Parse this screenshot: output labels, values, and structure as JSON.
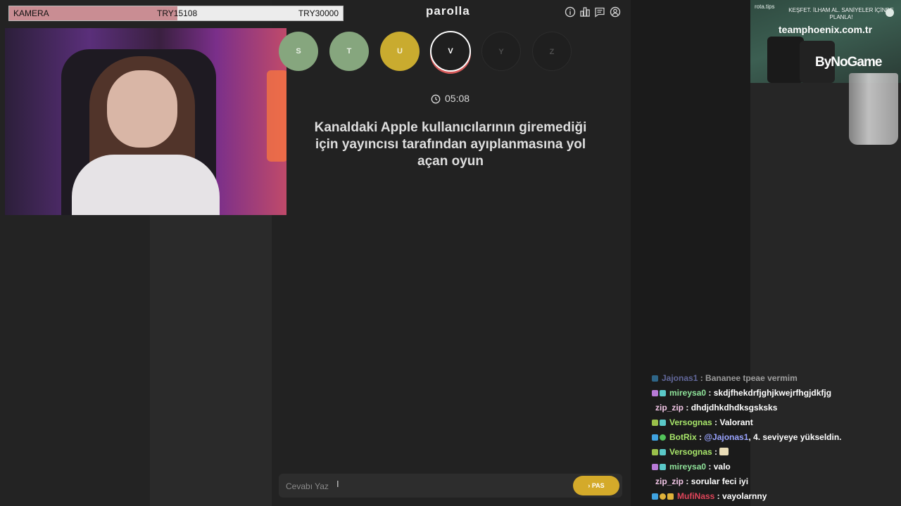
{
  "donation": {
    "label": "KAMERA",
    "current": "TRY15108",
    "goal": "TRY30000",
    "progress_fraction": 0.504
  },
  "header": {
    "logo": "parolla"
  },
  "header_icons": [
    "info-icon",
    "stats-icon",
    "feedback-icon",
    "account-icon"
  ],
  "letters": [
    {
      "letter": "S",
      "state": "correct"
    },
    {
      "letter": "T",
      "state": "correct"
    },
    {
      "letter": "U",
      "state": "passed"
    },
    {
      "letter": "V",
      "state": "active"
    },
    {
      "letter": "Y",
      "state": "pending"
    },
    {
      "letter": "Z",
      "state": "pending"
    }
  ],
  "timer": "05:08",
  "question": "Kanaldaki Apple kullanıcılarının giremediği için yayıncısı tarafından ayıplanmasına yol açan oyun",
  "answer": {
    "placeholder": "Cevabı Yaz",
    "pass_label": "PAS"
  },
  "ad": {
    "brand": "rota.tips",
    "tagline": "KEŞFET. İLHAM AL. SANİYELER İÇİNDE PLANLA!",
    "site": "teamphoenix.com.tr",
    "logo": "ByNoGame"
  },
  "chat": [
    {
      "user": "Jajonas1",
      "message": "Bananee tpeae vermim",
      "user_color": "#9aa4ff"
    },
    {
      "user": "mireysa0",
      "message": "skdjfhekdrfjghjkwejrfhgjdkfjg",
      "user_color": "#8fe39a"
    },
    {
      "user": "zip_zip",
      "message": "dhdjdhkdhdksgsksks",
      "user_color": "#f2c6e6"
    },
    {
      "user": "Versognas",
      "message": "Valorant",
      "user_color": "#a8e66a"
    },
    {
      "user": "BotRix",
      "message_mention": "@Jajonas1",
      "message": ", 4. seviyeye yükseldin.",
      "user_color": "#a8e66a"
    },
    {
      "user": "Versognas",
      "message": "",
      "emote": "emote",
      "user_color": "#a8e66a"
    },
    {
      "user": "mireysa0",
      "message": "valo",
      "user_color": "#8fe39a"
    },
    {
      "user": "zip_zip",
      "message": "sorular feci iyi",
      "user_color": "#f2c6e6"
    },
    {
      "user": "MufiNass",
      "message": "vayolarnny",
      "user_color": "#e0455a"
    }
  ],
  "colors": {
    "accent": "#d4aa2a",
    "correct": "#86a67e",
    "passed": "#c9ab2f",
    "active_ring": "#d65a5a"
  }
}
